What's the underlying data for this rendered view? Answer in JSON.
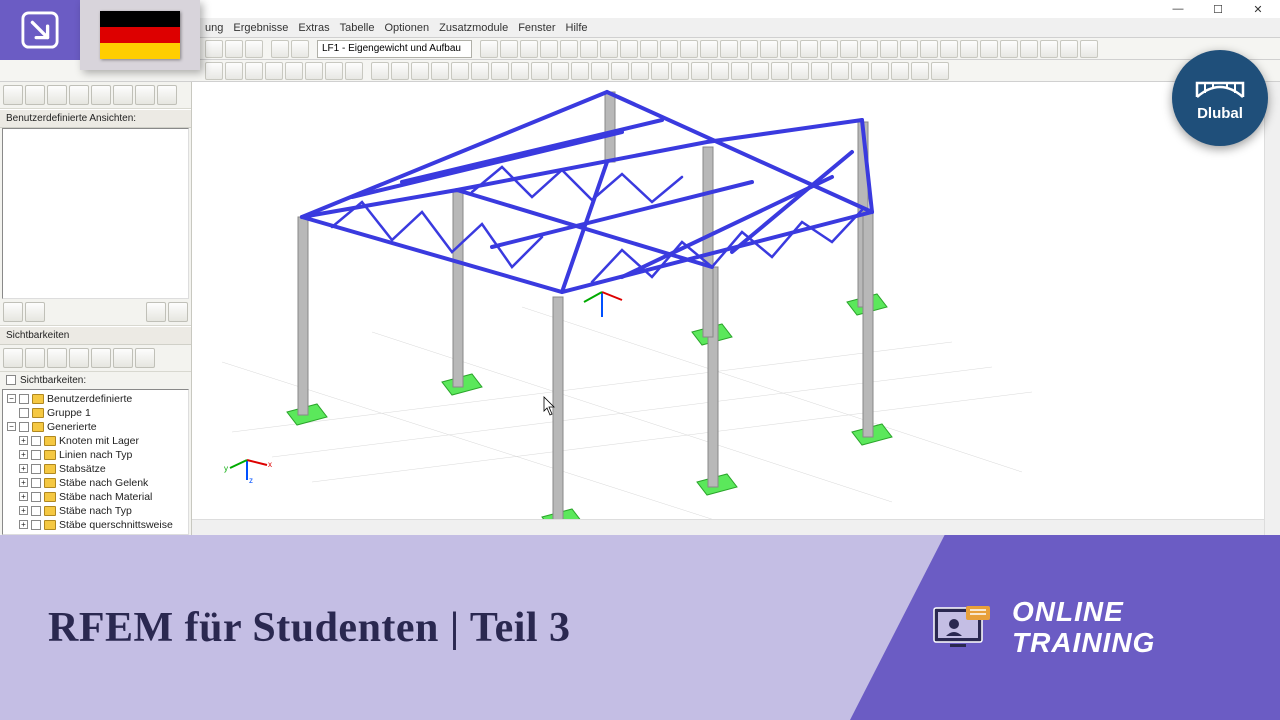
{
  "window": {
    "controls": {
      "min": "—",
      "max": "☐",
      "close": "✕"
    }
  },
  "menu": {
    "items": [
      "ung",
      "Ergebnisse",
      "Extras",
      "Tabelle",
      "Optionen",
      "Zusatzmodule",
      "Fenster",
      "Hilfe"
    ]
  },
  "toolbar": {
    "load_case": "LF1 - Eigengewicht und Aufbau"
  },
  "panel": {
    "views_label": "Benutzerdefinierte Ansichten:",
    "visibilities_header": "Sichtbarkeiten",
    "visibilities_checkbox": "Sichtbarkeiten:",
    "tree": {
      "user_defined": "Benutzerdefinierte",
      "group1": "Gruppe 1",
      "generated": "Generierte",
      "items": [
        "Knoten mit Lager",
        "Linien nach Typ",
        "Stabsätze",
        "Stäbe nach Gelenk",
        "Stäbe nach Material",
        "Stäbe nach Typ",
        "Stäbe querschnittsweise"
      ]
    }
  },
  "brand": {
    "name": "Dlubal"
  },
  "banner": {
    "title": "RFEM für Studenten | Teil 3",
    "tag_line1": "ONLINE",
    "tag_line2": "TRAINING"
  },
  "flag": {
    "country": "Germany",
    "stripes": [
      "#000000",
      "#dd0000",
      "#ffce00"
    ]
  }
}
